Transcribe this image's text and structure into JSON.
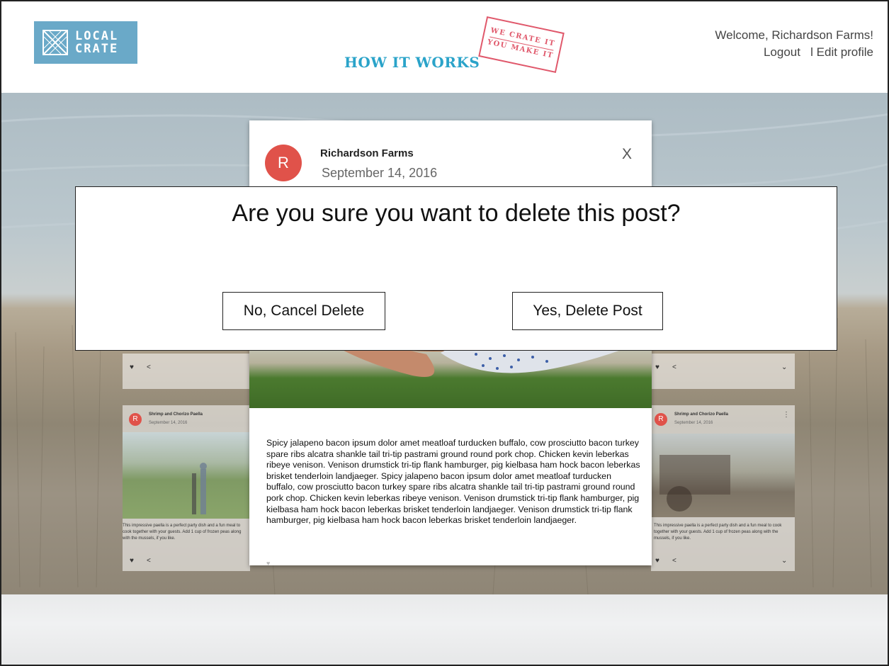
{
  "header": {
    "logo_line1": "LOCAL",
    "logo_line2": "CRATE",
    "nav_how_it_works": "HOW IT WORKS",
    "stamp_line1": "WE CRATE IT",
    "stamp_line2": "YOU MAKE IT",
    "welcome": "Welcome, Richardson Farms!",
    "logout": "Logout",
    "separator": "l",
    "edit_profile": "Edit profile"
  },
  "colors": {
    "brand_blue": "#6aa9c8",
    "accent_cyan": "#2aa3c9",
    "stamp_red": "#e0586b",
    "avatar_red": "#e0524a"
  },
  "side_cards": {
    "left_title": "Shrimp and Chorizo Paella",
    "left_date": "September 14, 2016",
    "left_text": "This impressive paella is a perfect party dish and a fun meal to cook together with your guests. Add 1 cup of frozen peas along with the mussels, if you like.",
    "right_title": "Shrimp and Chorizo Paella",
    "right_date": "September 14, 2016",
    "right_text": "This impressive paella is a perfect party dish and a fun meal to cook together with your guests. Add 1 cup of frozen peas along with the mussels, if you like.",
    "avatar_letter": "R"
  },
  "post": {
    "avatar_letter": "R",
    "author": "Richardson Farms",
    "date": "September 14, 2016",
    "close_label": "X",
    "body": "Spicy jalapeno bacon ipsum dolor amet meatloaf turducken buffalo, cow prosciutto bacon turkey spare ribs alcatra shankle tail tri-tip pastrami ground round pork chop. Chicken kevin leberkas ribeye venison. Venison drumstick tri-tip flank hamburger, pig kielbasa ham hock bacon leberkas brisket tenderloin landjaeger. Spicy jalapeno bacon ipsum dolor amet meatloaf turducken buffalo, cow prosciutto bacon turkey spare ribs alcatra shankle tail tri-tip pastrami ground round pork chop. Chicken kevin leberkas ribeye venison. Venison drumstick tri-tip flank hamburger, pig kielbasa ham hock bacon leberkas brisket tenderloin landjaeger. Venison drumstick tri-tip flank hamburger, pig kielbasa ham hock bacon leberkas brisket tenderloin landjaeger."
  },
  "confirm": {
    "question": "Are you sure you want to delete this post?",
    "cancel_label": "No, Cancel Delete",
    "delete_label": "Yes, Delete Post"
  }
}
